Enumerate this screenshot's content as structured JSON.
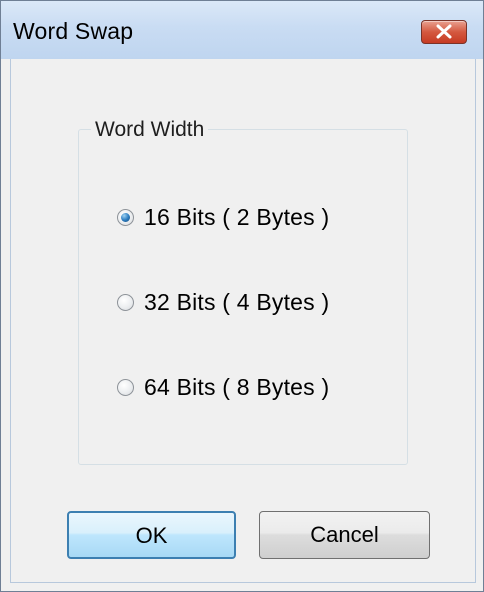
{
  "window": {
    "title": "Word Swap"
  },
  "group": {
    "label": "Word Width",
    "options": [
      {
        "label": "16 Bits ( 2 Bytes )",
        "checked": true
      },
      {
        "label": "32 Bits ( 4 Bytes )",
        "checked": false
      },
      {
        "label": "64 Bits ( 8 Bytes )",
        "checked": false
      }
    ]
  },
  "buttons": {
    "ok_label": "OK",
    "cancel_label": "Cancel"
  },
  "colors": {
    "titlebar": "#c9dcf3",
    "close_button": "#c63b23",
    "default_button_border": "#3c7fb1",
    "radio_selected": "#2f7fc2"
  },
  "icons": {
    "close": "close-icon"
  }
}
